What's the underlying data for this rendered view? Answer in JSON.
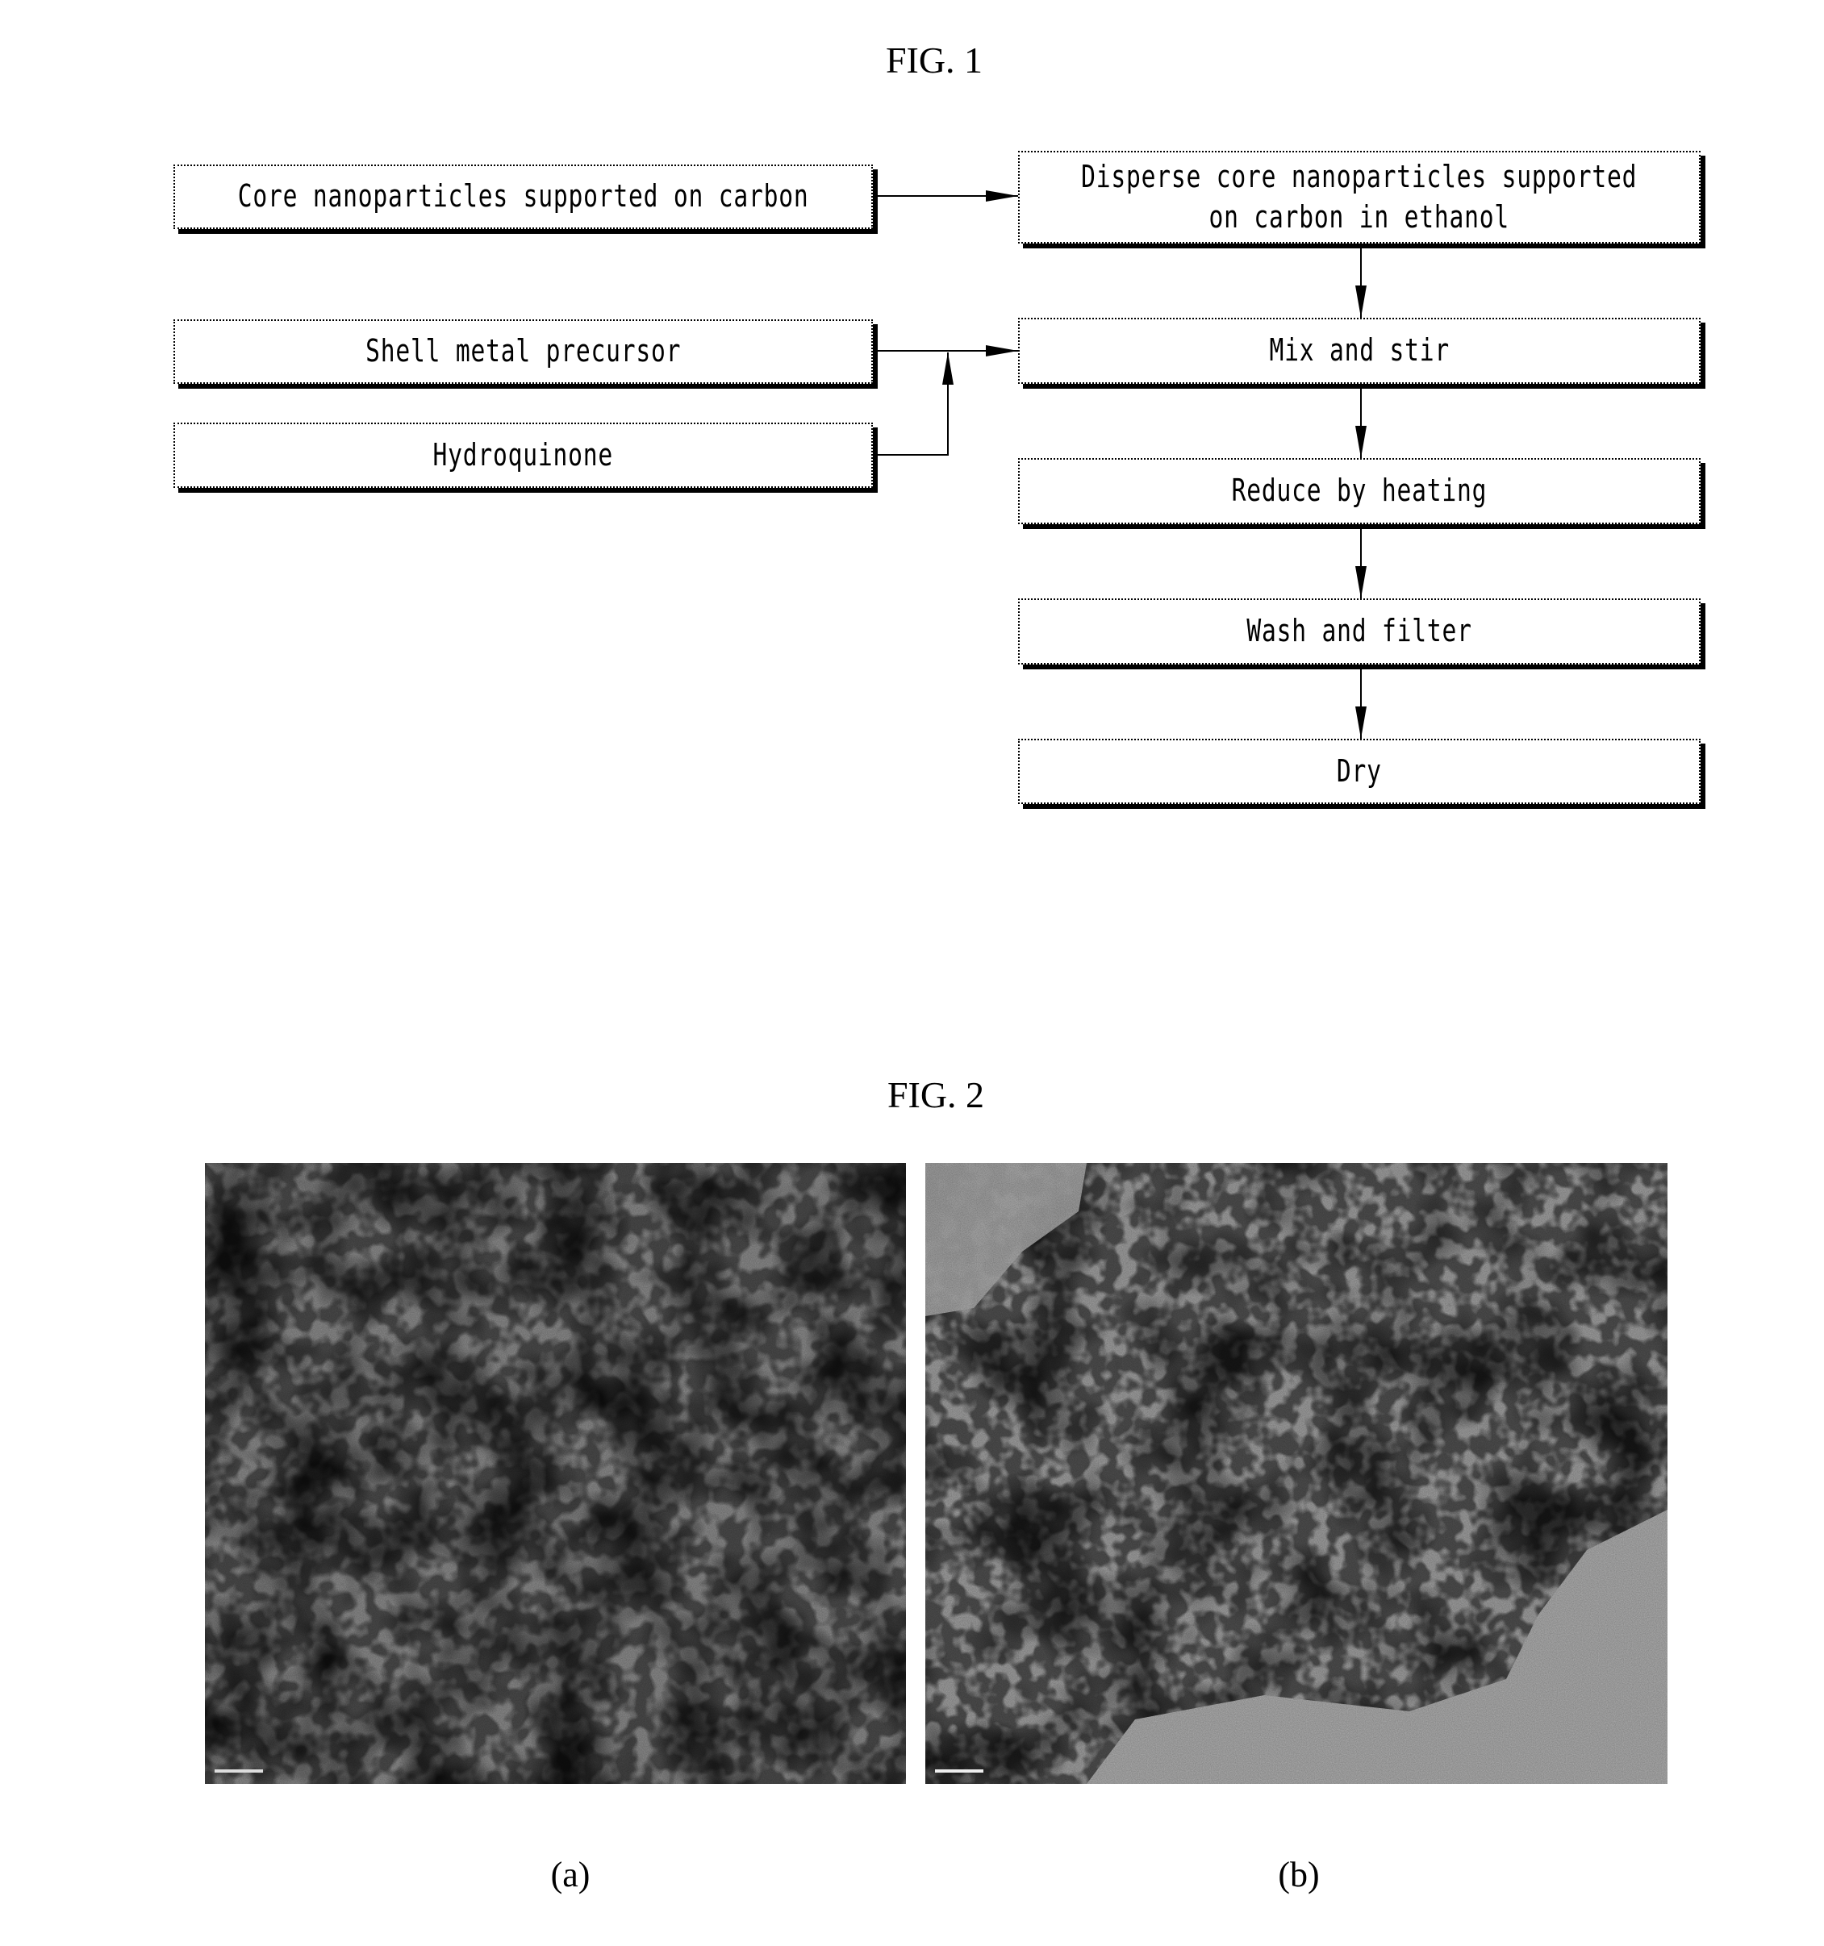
{
  "figure1": {
    "title": "FIG. 1",
    "inputs": [
      {
        "id": "core",
        "label": "Core nanoparticles supported on carbon"
      },
      {
        "id": "shell",
        "label": "Shell metal precursor"
      },
      {
        "id": "hydroquinone",
        "label": "Hydroquinone"
      }
    ],
    "steps": [
      {
        "id": "disperse",
        "lines": [
          "Disperse core nanoparticles supported",
          "on carbon in ethanol"
        ]
      },
      {
        "id": "mix",
        "label": "Mix and stir"
      },
      {
        "id": "reduce",
        "label": "Reduce by heating"
      },
      {
        "id": "wash",
        "label": "Wash and filter"
      },
      {
        "id": "dry",
        "label": "Dry"
      }
    ],
    "edges": [
      {
        "from": "core",
        "to": "disperse"
      },
      {
        "from": "shell",
        "to": "mix"
      },
      {
        "from": "hydroquinone",
        "to": "mix"
      },
      {
        "from": "disperse",
        "to": "mix"
      },
      {
        "from": "mix",
        "to": "reduce"
      },
      {
        "from": "reduce",
        "to": "wash"
      },
      {
        "from": "wash",
        "to": "dry"
      }
    ]
  },
  "figure2": {
    "title": "FIG. 2",
    "panels": [
      {
        "label": "(a)",
        "image": "TEM micrograph of carbon-supported nanoparticles (a)"
      },
      {
        "label": "(b)",
        "image": "TEM micrograph of carbon-supported nanoparticles (b)"
      }
    ]
  }
}
